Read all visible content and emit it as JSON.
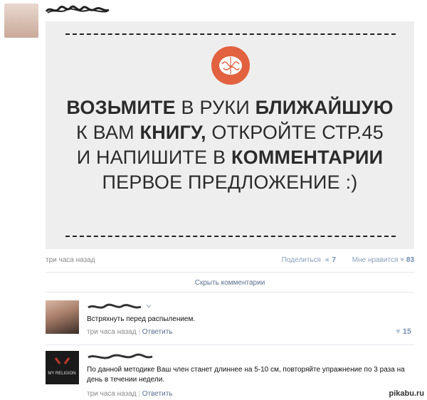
{
  "post": {
    "headline_lines": [
      [
        {
          "t": "ВОЗЬМИТЕ",
          "b": true
        },
        {
          "t": " В РУКИ ",
          "b": false
        },
        {
          "t": "БЛИЖАЙШУЮ",
          "b": true
        }
      ],
      [
        {
          "t": "К ВАМ ",
          "b": false
        },
        {
          "t": "КНИГУ,",
          "b": true
        },
        {
          "t": " ОТКРОЙТЕ СТР.45",
          "b": false
        }
      ],
      [
        {
          "t": "И НАПИШИТЕ В ",
          "b": false
        },
        {
          "t": "КОММЕНТАРИИ",
          "b": true
        }
      ],
      [
        {
          "t": "ПЕРВОЕ ПРЕДЛОЖЕНИЕ :)",
          "b": false
        }
      ]
    ],
    "time": "три часа назад",
    "share_label": "Поделиться",
    "share_count": "7",
    "like_label": "Мне нравится",
    "like_count": "83",
    "accent_color": "#e2613f"
  },
  "hide_comments_label": "Скрыть комментарии",
  "comments": [
    {
      "text": "Встряхнуть перед распылением.",
      "time": "три часа назад",
      "reply_label": "Ответить",
      "likes": "15"
    },
    {
      "text": "По данной методике Ваш член станет длиннее на 5-10 см, повторяйте упражнение по 3 раза на день в течении недели.",
      "time": "три часа назад",
      "reply_label": "Ответить",
      "likes": "",
      "avatar_text": "MY RELIGION"
    }
  ],
  "watermark": "pikabu.ru"
}
